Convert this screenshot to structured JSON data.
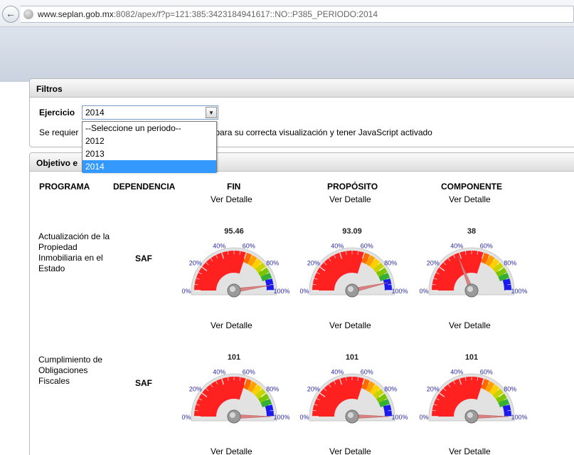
{
  "browser": {
    "url_domain": "www.seplan.gob.mx",
    "url_rest": ":8082/apex/f?p=121:385:3423184941617::NO::P385_PERIODO:2014"
  },
  "filtros": {
    "title": "Filtros",
    "ejercicio_label": "Ejercicio",
    "selected": "2014",
    "note_start": "Se requier",
    "note_link": "er",
    "note_end": " para su correcta visualización y tener JavaScript activado",
    "options": [
      "--Seleccione un periodo--",
      "2012",
      "2013",
      "2014"
    ]
  },
  "objetivo": {
    "title": "Objetivo e",
    "headers": {
      "programa": "PROGRAMA",
      "dependencia": "DEPENDENCIA",
      "fin": "FIN",
      "proposito": "PROPÓSITO",
      "componente": "COMPONENTE"
    },
    "ver_detalle": "Ver Detalle",
    "rows": [
      {
        "programa": "Actualización de la Propiedad Inmobiliaria en el Estado",
        "dependencia": "SAF",
        "gauges": [
          95.46,
          93.09,
          38
        ]
      },
      {
        "programa": "Cumplimiento de Obligaciones Fiscales",
        "dependencia": "SAF",
        "gauges": [
          101,
          101,
          101
        ]
      }
    ]
  },
  "gauge_labels": [
    "0%",
    "20%",
    "40%",
    "60%",
    "80%",
    "100%"
  ],
  "colors": {
    "red": "#ff2020",
    "green": "#22aa22",
    "blue": "#1a1aee",
    "needle": "#d98080"
  }
}
